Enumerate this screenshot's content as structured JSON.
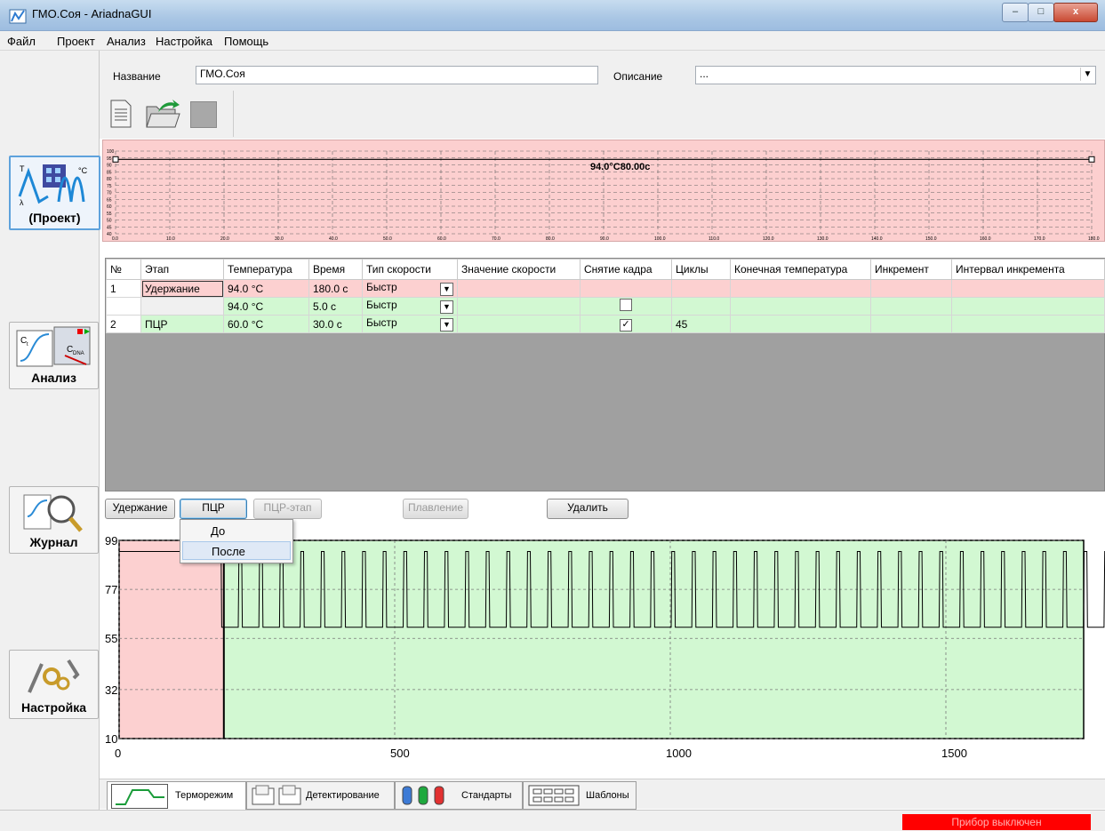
{
  "window": {
    "title": "ГМО.Соя - AriadnaGUI",
    "minimize_icon": "minimize-icon",
    "maximize_icon": "maximize-icon",
    "close_icon": "close-icon",
    "close_glyph": "x"
  },
  "menu": [
    "Файл",
    "Проект",
    "Анализ",
    "Настройка",
    "Помощь"
  ],
  "sidebar": {
    "items": [
      {
        "label": "(Проект)",
        "icon": "project-icon",
        "active": true
      },
      {
        "label": "Анализ",
        "icon": "analysis-icon",
        "active": false
      },
      {
        "label": "Журнал",
        "icon": "journal-icon",
        "active": false
      },
      {
        "label": "Настройка",
        "icon": "settings-icon",
        "active": false
      }
    ],
    "analysis_icon_text": {
      "ct": "C",
      "ct_sub": "t",
      "cdna": "C",
      "cdna_sub": "DNA"
    }
  },
  "header": {
    "name_label": "Название",
    "name_value": "ГМО.Соя",
    "description_label": "Описание",
    "description_value": "..."
  },
  "toolbar": {
    "icons": [
      "new-document-icon",
      "open-folder-icon",
      "disabled-square-icon"
    ]
  },
  "profile_top": {
    "label": "94.0°С80.00с",
    "y_ticks": [
      "100",
      "95",
      "90",
      "85",
      "80",
      "75",
      "70",
      "65",
      "60",
      "55",
      "50",
      "45",
      "40"
    ],
    "x_ticks": [
      "0.0",
      "10.0",
      "20.0",
      "30.0",
      "40.0",
      "50.0",
      "60.0",
      "70.0",
      "80.0",
      "90.0",
      "100.0",
      "110.0",
      "120.0",
      "130.0",
      "140.0",
      "150.0",
      "160.0",
      "170.0",
      "180.0"
    ],
    "bg_color": "#fccfcf"
  },
  "table": {
    "columns": [
      "№",
      "Этап",
      "Температура",
      "Время",
      "Тип скорости",
      "Значение скорости",
      "Снятие кадра",
      "Циклы",
      "Конечная температура",
      "Инкремент",
      "Интервал инкремента"
    ],
    "rows": [
      {
        "num": "1",
        "stage": "Удержание",
        "temp": "94.0 °C",
        "time": "180.0 c",
        "speed_type": "Быстр",
        "speed_value": "",
        "frame": null,
        "cycles": "",
        "color": "pink"
      },
      {
        "num": "",
        "stage": "",
        "temp": "94.0 °C",
        "time": "5.0 c",
        "speed_type": "Быстр",
        "speed_value": "",
        "frame": false,
        "cycles": "",
        "color": "green"
      },
      {
        "num": "2",
        "stage": "ПЦР",
        "temp": "60.0 °C",
        "time": "30.0 c",
        "speed_type": "Быстр",
        "speed_value": "",
        "frame": true,
        "cycles": "45",
        "color": "green"
      }
    ],
    "check_glyph": "✓",
    "dropdown_glyph": "▼"
  },
  "actions": {
    "hold": "Удержание",
    "pcr": "ПЦР",
    "pcr_step": "ПЦР-этап",
    "melt": "Плавление",
    "delete": "Удалить"
  },
  "popup": {
    "items": [
      "До",
      "После"
    ],
    "highlighted": "После"
  },
  "bottom_chart": {
    "y_ticks": [
      "99",
      "77",
      "55",
      "32",
      "10"
    ],
    "x_ticks": [
      "0",
      "500",
      "1000",
      "1500"
    ],
    "hold_color": "#fcd0d0",
    "pcr_color": "#d2f8d2"
  },
  "tabs": [
    {
      "label": "Терморежим",
      "icon": "thermal-profile-icon",
      "active": true
    },
    {
      "label": "Детектирование",
      "icon": "detection-icon",
      "active": false
    },
    {
      "label": "Стандарты",
      "icon": "tubes-icon",
      "active": false
    },
    {
      "label": "Шаблоны",
      "icon": "plate-icon",
      "active": false
    }
  ],
  "status": {
    "device": "Прибор выключен"
  }
}
